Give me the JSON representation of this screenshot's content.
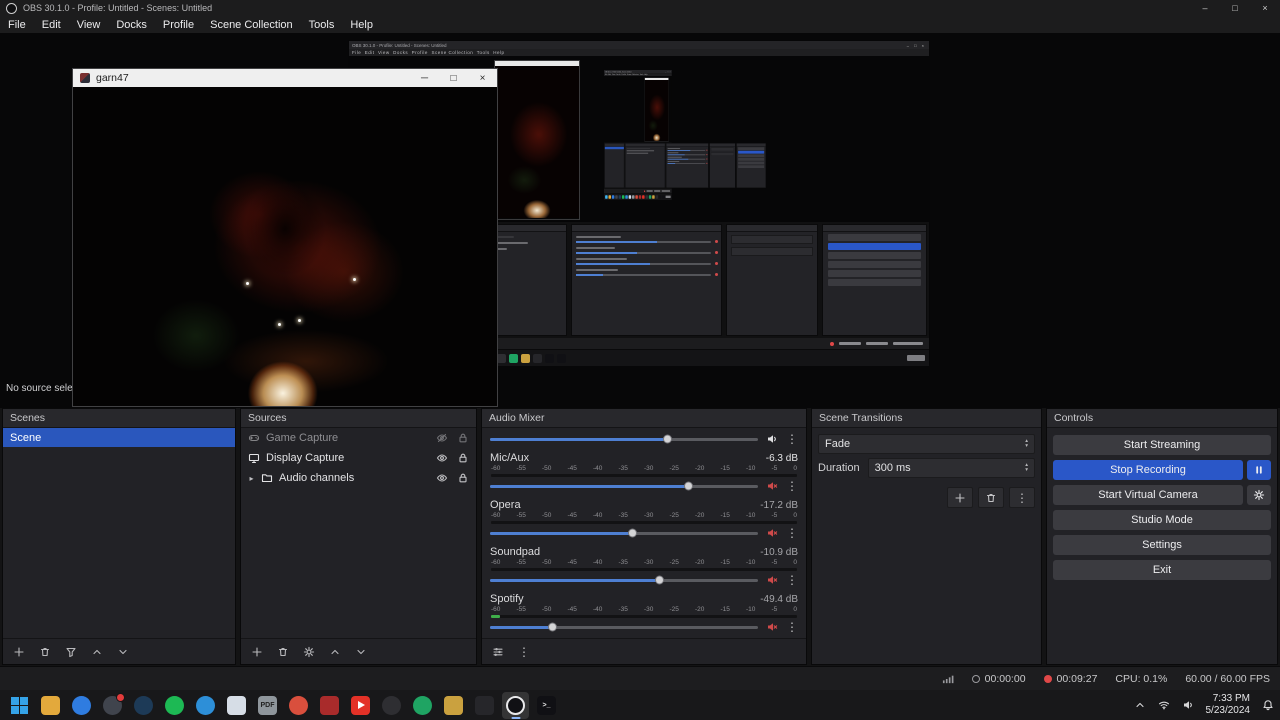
{
  "window": {
    "title": "OBS 30.1.0 - Profile: Untitled - Scenes: Untitled",
    "controls": {
      "minimize": "–",
      "maximize": "□",
      "close": "×"
    }
  },
  "menu": {
    "items": [
      "File",
      "Edit",
      "View",
      "Docks",
      "Profile",
      "Scene Collection",
      "Tools",
      "Help"
    ]
  },
  "preview": {
    "no_source_text": "No source select",
    "game_window": {
      "title": "garn47",
      "minimize": "─",
      "maximize": "□",
      "close": "×"
    }
  },
  "scenes": {
    "title": "Scenes",
    "items": [
      {
        "label": "Scene",
        "selected": true
      }
    ]
  },
  "sources": {
    "title": "Sources",
    "items": [
      {
        "label": "Game Capture",
        "icon": "gamepad-icon",
        "visible": false,
        "locked": true
      },
      {
        "label": "Display Capture",
        "icon": "monitor-icon",
        "visible": true,
        "locked": true
      },
      {
        "label": "Audio channels",
        "icon": "folder-icon",
        "visible": true,
        "locked": true,
        "expandable": true
      }
    ]
  },
  "audio_mixer": {
    "title": "Audio Mixer",
    "scale_ticks": [
      "-60",
      "-55",
      "-50",
      "-45",
      "-40",
      "-35",
      "-30",
      "-25",
      "-20",
      "-15",
      "-10",
      "-5",
      "0"
    ],
    "master": {
      "slider": 0.66,
      "muted": false
    },
    "channels": [
      {
        "name": "Mic/Aux",
        "db": "-6.3 dB",
        "slider": 0.74,
        "muted": true,
        "meter": 0
      },
      {
        "name": "Opera",
        "db": "-17.2 dB",
        "slider": 0.53,
        "muted": true,
        "meter": 0
      },
      {
        "name": "Soundpad",
        "db": "-10.9 dB",
        "slider": 0.63,
        "muted": true,
        "meter": 0
      },
      {
        "name": "Spotify",
        "db": "-49.4 dB",
        "slider": 0.23,
        "muted": true,
        "meter": 0.03
      }
    ]
  },
  "scene_transitions": {
    "title": "Scene Transitions",
    "transition": "Fade",
    "duration_label": "Duration",
    "duration_value": "300 ms"
  },
  "controls": {
    "title": "Controls",
    "start_streaming": "Start Streaming",
    "stop_recording": "Stop Recording",
    "start_virtual_camera": "Start Virtual Camera",
    "studio_mode": "Studio Mode",
    "settings": "Settings",
    "exit": "Exit"
  },
  "status_bar": {
    "stream_time": "00:00:00",
    "recording_time": "00:09:27",
    "cpu": "CPU: 0.1%",
    "fps": "60.00 / 60.00 FPS"
  },
  "taskbar": {
    "clock": {
      "time": "7:33 PM",
      "date": "5/23/2024"
    },
    "apps": [
      {
        "name": "start",
        "glyph": "win"
      },
      {
        "name": "file-explorer",
        "glyph": "sq",
        "bg": "#e3a93c"
      },
      {
        "name": "browser-edge",
        "glyph": "circle",
        "bg": "#2f7ce0"
      },
      {
        "name": "discord",
        "glyph": "circle",
        "bg": "#40444d",
        "badge": true
      },
      {
        "name": "steam",
        "glyph": "circle",
        "bg": "#1d3a57"
      },
      {
        "name": "spotify",
        "glyph": "circle",
        "bg": "#1db954"
      },
      {
        "name": "firefox",
        "glyph": "circle",
        "bg": "#2d8fd8"
      },
      {
        "name": "cursor-tool",
        "glyph": "sq",
        "bg": "#d6dde6"
      },
      {
        "name": "pdf-viewer",
        "glyph": "sq",
        "bg": "#8f969c",
        "text": "PDF",
        "fg": "#222222"
      },
      {
        "name": "chrome",
        "glyph": "circle",
        "bg": "#d94f3d"
      },
      {
        "name": "adobe",
        "glyph": "sq",
        "bg": "#a92b2b"
      },
      {
        "name": "youtube",
        "glyph": "play",
        "bg": "#e33127"
      },
      {
        "name": "app-dark",
        "glyph": "circle",
        "bg": "#2e2e32"
      },
      {
        "name": "app-green",
        "glyph": "circle",
        "bg": "#1fa463"
      },
      {
        "name": "app-wheat",
        "glyph": "sq",
        "bg": "#caa13f"
      },
      {
        "name": "app-black",
        "glyph": "sq",
        "bg": "#26262a"
      },
      {
        "name": "obs",
        "glyph": "obs",
        "bg": "#101014",
        "active": true
      },
      {
        "name": "terminal",
        "glyph": "sq",
        "bg": "#101014",
        "text": ">_",
        "fg": "#e8e8e8"
      }
    ]
  },
  "colors": {
    "accent_blue": "#2a57c8",
    "selection_blue": "#2a57bd",
    "muted_red": "#cf4a4a",
    "record_red": "#e04848",
    "meter_green": "#3fae4a",
    "panel_bg": "#222226",
    "taskbar_bg": "#18181a"
  }
}
